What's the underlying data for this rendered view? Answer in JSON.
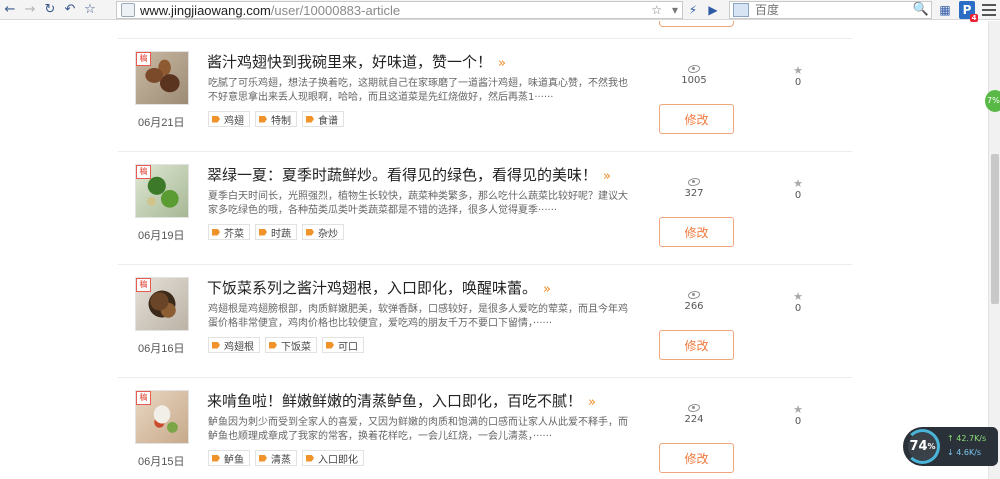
{
  "browser": {
    "url_host": "www.jingjiaowang.com",
    "url_path": "/user/10000883-article",
    "search_placeholder": "百度",
    "extension_badge": "4"
  },
  "articles": [
    {
      "title": "酱汁鸡翅快到我碗里来，好味道，赞一个！",
      "summary": "吃腻了可乐鸡翅，想法子换着吃，这期就自己在家琢磨了一道酱汁鸡翅，味道真心赞，不然我也不好意思拿出来丢人现眼啊，哈哈，而且这道菜是先红烧做好，然后再蒸1······",
      "tags": [
        "鸡翅",
        "特制",
        "食谱"
      ],
      "date": "06月21日",
      "views": "1005",
      "likes": "0",
      "edit_label": "修改",
      "draft_label": "稿"
    },
    {
      "title": "翠绿一夏：夏季时蔬鲜炒。看得见的绿色，看得见的美味！",
      "summary": "夏季白天时间长，光照强烈，植物生长较快，蔬菜种类繁多，那么吃什么蔬菜比较好呢？建议大家多吃绿色的哦，各种茄类瓜类叶类蔬菜都是不错的选择，很多人觉得夏季······",
      "tags": [
        "芥菜",
        "时蔬",
        "杂炒"
      ],
      "date": "06月19日",
      "views": "327",
      "likes": "0",
      "edit_label": "修改",
      "draft_label": "稿"
    },
    {
      "title": "下饭菜系列之酱汁鸡翅根，入口即化，唤醒味蕾。",
      "summary": "鸡翅根是鸡翅膀根部，肉质鲜嫩肥美，软弹香酥，口感较好，是很多人爱吃的荤菜，而且今年鸡蛋价格非常便宜，鸡肉价格也比较便宜，爱吃鸡的朋友千万不要口下留情，······",
      "tags": [
        "鸡翅根",
        "下饭菜",
        "可口"
      ],
      "date": "06月16日",
      "views": "266",
      "likes": "0",
      "edit_label": "修改",
      "draft_label": "稿"
    },
    {
      "title": "来啃鱼啦！鲜嫩鲜嫩的清蒸鲈鱼，入口即化，百吃不腻！",
      "summary": "鲈鱼因为刺少而受到全家人的喜爱，又因为鲜嫩的肉质和饱满的口感而让家人从此爱不释手，而鲈鱼也顺理成章成了我家的常客，换着花样吃，一会儿红烧，一会儿清蒸，······",
      "tags": [
        "鲈鱼",
        "清蒸",
        "入口即化"
      ],
      "date": "06月15日",
      "views": "224",
      "likes": "0",
      "edit_label": "修改",
      "draft_label": "稿"
    }
  ],
  "side_widget": {
    "label": "7%"
  },
  "net_monitor": {
    "percent": "74",
    "percent_unit": "%",
    "up": "42.7K/s",
    "down": "4.6K/s"
  }
}
